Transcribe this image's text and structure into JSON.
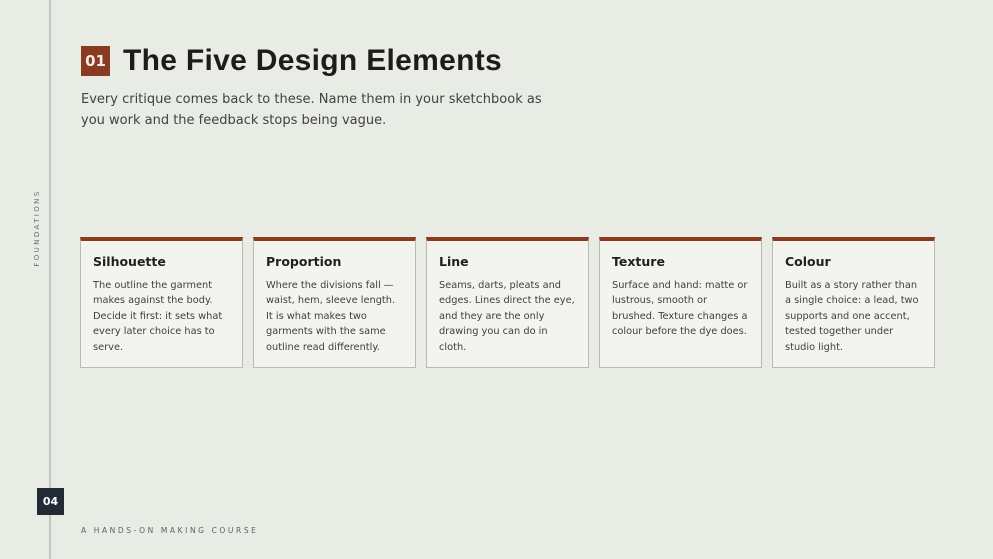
{
  "side_label": "FOUNDATIONS",
  "page_number": "04",
  "section_number": "01",
  "title": "The Five Design Elements",
  "intro": "Every critique comes back to these. Name them in your sketchbook as you work and the feedback stops being vague.",
  "cards": [
    {
      "title": "Silhouette",
      "body": "The outline the garment makes against the body. Decide it first: it sets what every later choice has to serve."
    },
    {
      "title": "Proportion",
      "body": "Where the divisions fall — waist, hem, sleeve length. It is what makes two garments with the same outline read differently."
    },
    {
      "title": "Line",
      "body": "Seams, darts, pleats and edges. Lines direct the eye, and they are the only drawing you can do in cloth."
    },
    {
      "title": "Texture",
      "body": "Surface and hand: matte or lustrous, smooth or brushed. Texture changes a colour before the dye does."
    },
    {
      "title": "Colour",
      "body": "Built as a story rather than a single choice: a lead, two supports and one accent, tested together under studio light."
    }
  ],
  "footer": "A HANDS-ON MAKING COURSE",
  "colors": {
    "accent": "#8a3a22",
    "page_badge": "#222a35",
    "background": "#e9ebe5"
  }
}
